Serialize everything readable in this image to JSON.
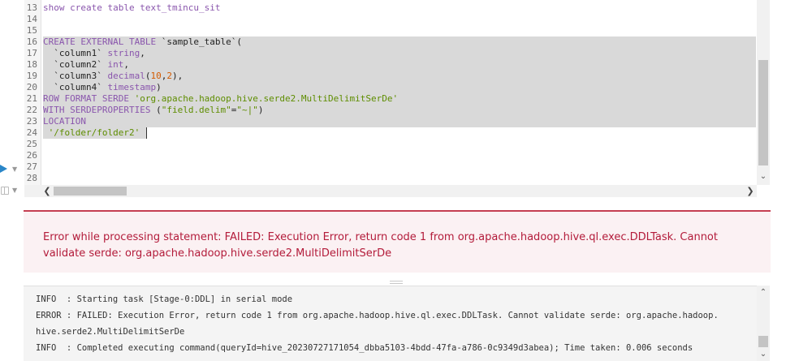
{
  "editor": {
    "line_numbers": [
      "13",
      "14",
      "15",
      "16",
      "17",
      "18",
      "19",
      "20",
      "21",
      "22",
      "23",
      "24",
      "25",
      "26",
      "27",
      "28"
    ],
    "lines": {
      "l13": "show create table text_tmincu_sit",
      "l16a": "CREATE EXTERNAL TABLE",
      "l16b": " `sample_table`(",
      "l17a": "  `column1` ",
      "l17b": "string",
      "l17c": ",",
      "l18a": "  `column2` ",
      "l18b": "int",
      "l18c": ",",
      "l19a": "  `column3` ",
      "l19b": "decimal",
      "l19c": "(",
      "l19d": "10",
      "l19e": ",",
      "l19f": "2",
      "l19g": "),",
      "l20a": "  `column4` ",
      "l20b": "timestamp",
      "l20c": ")",
      "l21a": "ROW FORMAT SERDE ",
      "l21b": "'org.apache.hadoop.hive.serde2.MultiDelimitSerDe'",
      "l22a": "WITH SERDEPROPERTIES ",
      "l22b": "(",
      "l22c": "\"field.delim\"",
      "l22d": "=",
      "l22e": "\"~|\"",
      "l22f": ")",
      "l23": "LOCATION",
      "l24": " '/folder/folder2'"
    }
  },
  "error": {
    "message": "Error while processing statement: FAILED: Execution Error, return code 1 from org.apache.hadoop.hive.ql.exec.DDLTask. Cannot validate serde: org.apache.hadoop.hive.serde2.MultiDelimitSerDe"
  },
  "log": {
    "lines": [
      "INFO  : Starting task [Stage-0:DDL] in serial mode",
      "ERROR : FAILED: Execution Error, return code 1 from org.apache.hadoop.hive.ql.exec.DDLTask. Cannot validate serde: org.apache.hadoop.",
      "hive.serde2.MultiDelimitSerDe",
      "INFO  : Completed executing command(queryId=hive_20230727171054_dbba5103-4bdd-47fa-a786-0c9349d3abea); Time taken: 0.006 seconds"
    ]
  },
  "icons": {
    "run": "play-icon",
    "map": "map-icon",
    "scroll_up": "▲",
    "scroll_down": "▼",
    "scroll_left": "❮",
    "scroll_right": "❯",
    "caret": "▼",
    "v_down": "⌄",
    "log_up": "⌃",
    "log_down": "⌄"
  },
  "colors": {
    "run_icon": "#2a86c8",
    "error_border": "#c53e52",
    "error_text": "#b31b3a",
    "selection": "#d9d9d9"
  }
}
